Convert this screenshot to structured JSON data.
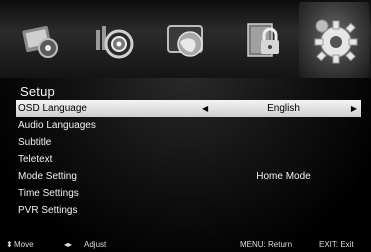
{
  "menu_icons": [
    {
      "name": "picture-menu-icon",
      "active": false
    },
    {
      "name": "sound-menu-icon",
      "active": false
    },
    {
      "name": "channel-menu-icon",
      "active": false
    },
    {
      "name": "lock-menu-icon",
      "active": false
    },
    {
      "name": "setup-gear-icon",
      "active": true
    }
  ],
  "section_title": "Setup",
  "menu": {
    "items": [
      {
        "label": "OSD Language",
        "value": "English",
        "selected": true
      },
      {
        "label": "Audio Languages",
        "value": ""
      },
      {
        "label": "Subtitle",
        "value": ""
      },
      {
        "label": "Teletext",
        "value": ""
      },
      {
        "label": "Mode Setting",
        "value": "Home Mode"
      },
      {
        "label": "Time Settings",
        "value": ""
      },
      {
        "label": "PVR Settings",
        "value": ""
      }
    ]
  },
  "footer": {
    "move_icon": "up-down-arrows-icon",
    "move": "Move",
    "adjust_icon": "left-right-arrows-icon",
    "adjust": "Adjust",
    "return": "MENU: Return",
    "exit": "EXIT: Exit"
  },
  "colors": {
    "highlight_top": "#f4f4f4",
    "highlight_bottom": "#cfcfcf",
    "background": "#000000"
  }
}
